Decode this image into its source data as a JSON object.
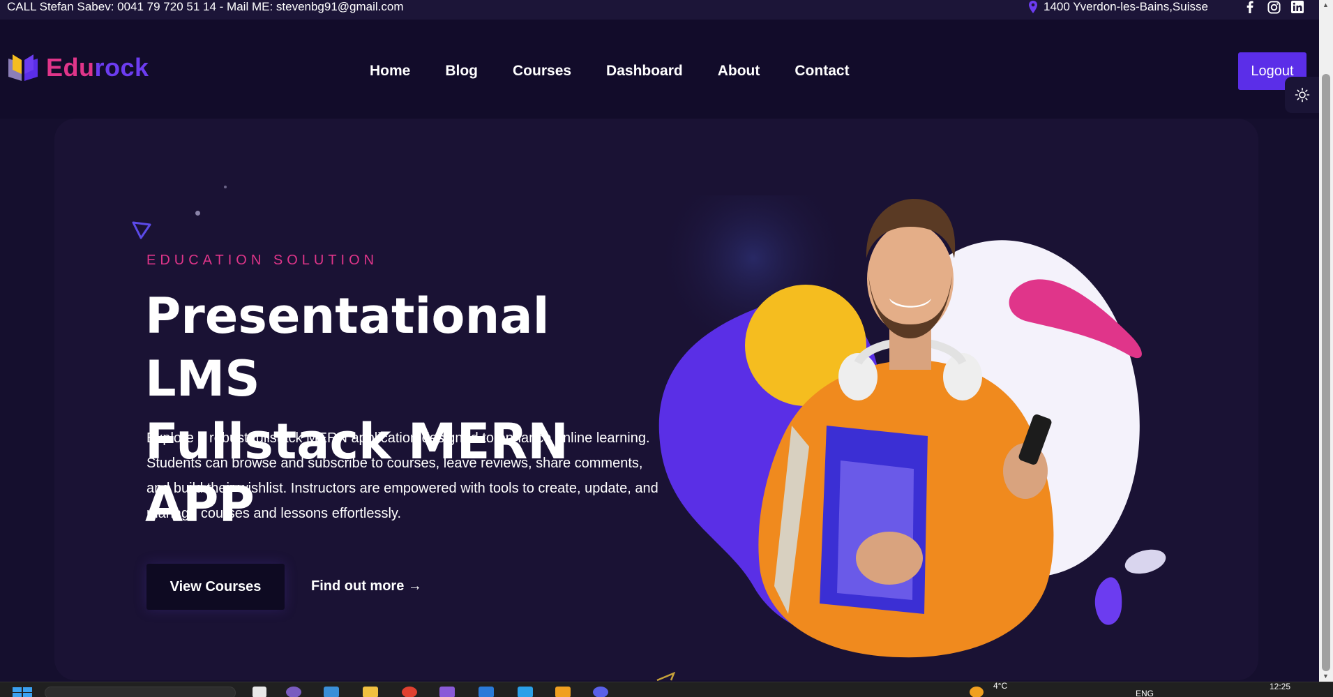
{
  "topbar": {
    "contact": "CALL Stefan Sabev: 0041 79 720 51 14 - Mail ME: stevenbg91@gmail.com",
    "location": "1400 Yverdon-les-Bains,Suisse",
    "social_icons": [
      "facebook-icon",
      "instagram-icon",
      "linkedin-icon"
    ]
  },
  "header": {
    "logo": {
      "part1": "Edu",
      "part2": "rock"
    },
    "nav": [
      "Home",
      "Blog",
      "Courses",
      "Dashboard",
      "About",
      "Contact"
    ],
    "logout_label": "Logout"
  },
  "hero": {
    "eyebrow": "EDUCATION SOLUTION",
    "headline_line1": "Presentational LMS",
    "headline_line2": "Fullstack MERN APP",
    "lead": "Explore a robust fullstack MERN application designed to enhance online learning. Students can browse and subscribe to courses, leave reviews, share comments, and build their wishlist. Instructors are empowered with tools to create, update, and manage courses and lessons effortlessly.",
    "primary_button": "View Courses",
    "secondary_link": "Find out more →"
  },
  "taskbar": {
    "weather": "4°C",
    "language": "ENG",
    "time": "12:25"
  },
  "colors": {
    "accent_pink": "#e0358a",
    "accent_purple": "#5b2ee8",
    "background": "#150f2e",
    "orange": "#f08a1e",
    "yellow": "#f5bd1f"
  }
}
